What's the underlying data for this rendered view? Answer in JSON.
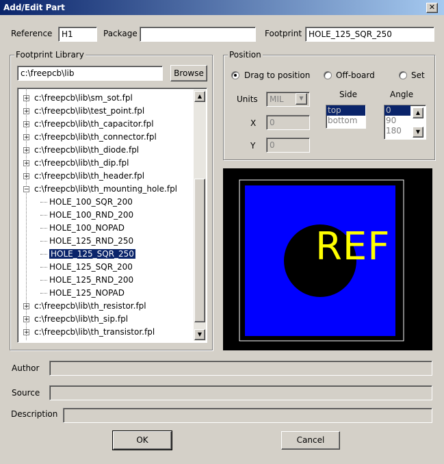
{
  "window": {
    "title": "Add/Edit Part",
    "close_symbol": "✕"
  },
  "top": {
    "reference_label": "Reference",
    "reference_value": "H1",
    "package_label": "Package",
    "package_value": "",
    "footprint_label": "Footprint",
    "footprint_value": "HOLE_125_SQR_250"
  },
  "library": {
    "legend": "Footprint Library",
    "path_value": "c:\\freepcb\\lib",
    "browse_label": "Browse",
    "items": [
      {
        "text": "c:\\freepcb\\lib\\sm_sot.fpl",
        "level": 0,
        "exp": "+"
      },
      {
        "text": "c:\\freepcb\\lib\\test_point.fpl",
        "level": 0,
        "exp": "+"
      },
      {
        "text": "c:\\freepcb\\lib\\th_capacitor.fpl",
        "level": 0,
        "exp": "+"
      },
      {
        "text": "c:\\freepcb\\lib\\th_connector.fpl",
        "level": 0,
        "exp": "+"
      },
      {
        "text": "c:\\freepcb\\lib\\th_diode.fpl",
        "level": 0,
        "exp": "+"
      },
      {
        "text": "c:\\freepcb\\lib\\th_dip.fpl",
        "level": 0,
        "exp": "+"
      },
      {
        "text": "c:\\freepcb\\lib\\th_header.fpl",
        "level": 0,
        "exp": "+"
      },
      {
        "text": "c:\\freepcb\\lib\\th_mounting_hole.fpl",
        "level": 0,
        "exp": "−"
      },
      {
        "text": "HOLE_100_SQR_200",
        "level": 1
      },
      {
        "text": "HOLE_100_RND_200",
        "level": 1
      },
      {
        "text": "HOLE_100_NOPAD",
        "level": 1
      },
      {
        "text": "HOLE_125_RND_250",
        "level": 1
      },
      {
        "text": "HOLE_125_SQR_250",
        "level": 1,
        "selected": true
      },
      {
        "text": "HOLE_125_SQR_200",
        "level": 1
      },
      {
        "text": "HOLE_125_RND_200",
        "level": 1
      },
      {
        "text": "HOLE_125_NOPAD",
        "level": 1
      },
      {
        "text": "c:\\freepcb\\lib\\th_resistor.fpl",
        "level": 0,
        "exp": "+"
      },
      {
        "text": "c:\\freepcb\\lib\\th_sip.fpl",
        "level": 0,
        "exp": "+"
      },
      {
        "text": "c:\\freepcb\\lib\\th_transistor.fpl",
        "level": 0,
        "exp": "+"
      }
    ]
  },
  "position": {
    "legend": "Position",
    "drag_label": "Drag to position",
    "offboard_label": "Off-board",
    "set_label": "Set",
    "units_label": "Units",
    "units_value": "MIL",
    "side_label": "Side",
    "side_options": [
      "top",
      "bottom"
    ],
    "side_selected": "top",
    "angle_label": "Angle",
    "angle_options": [
      "0",
      "90",
      "180"
    ],
    "angle_selected": "0",
    "x_label": "X",
    "x_value": "0",
    "y_label": "Y",
    "y_value": "0"
  },
  "preview": {
    "ref_text": "REF",
    "colors": {
      "bg": "#000000",
      "copper": "#0000ff",
      "silk": "#ffff00",
      "outline": "#ffffff"
    }
  },
  "meta": {
    "author_label": "Author",
    "author_value": "",
    "source_label": "Source",
    "source_value": "",
    "description_label": "Description",
    "description_value": ""
  },
  "buttons": {
    "ok": "OK",
    "cancel": "Cancel"
  }
}
